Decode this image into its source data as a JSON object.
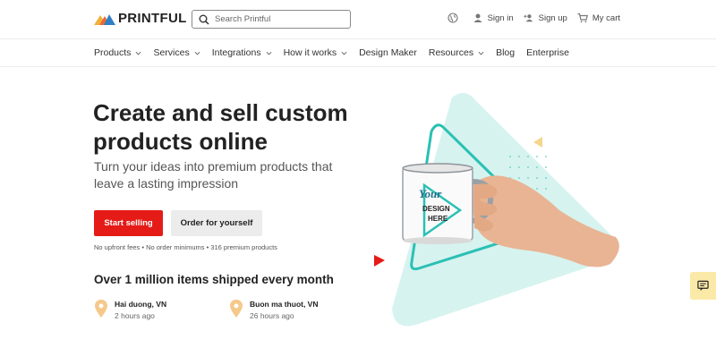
{
  "brand": {
    "name": "PRINTFUL"
  },
  "search": {
    "placeholder": "Search Printful"
  },
  "header_right": {
    "language_icon": "globe-icon",
    "sign_in": "Sign in",
    "sign_up": "Sign up",
    "cart": "My cart"
  },
  "nav": {
    "items": [
      {
        "label": "Products",
        "dropdown": true
      },
      {
        "label": "Services",
        "dropdown": true
      },
      {
        "label": "Integrations",
        "dropdown": true
      },
      {
        "label": "How it works",
        "dropdown": true
      },
      {
        "label": "Design Maker",
        "dropdown": false
      },
      {
        "label": "Resources",
        "dropdown": true
      },
      {
        "label": "Blog",
        "dropdown": false
      },
      {
        "label": "Enterprise",
        "dropdown": false
      }
    ]
  },
  "hero": {
    "title": "Create and sell custom products online",
    "subtitle": "Turn your ideas into premium products that leave a lasting impression",
    "primary_button": "Start selling",
    "secondary_button": "Order for yourself",
    "fineprint": "No upfront fees • No order minimums • 316 premium products"
  },
  "shipped": {
    "heading": "Over 1 million items shipped every month",
    "locations": [
      {
        "place": "Hai duong, VN",
        "time": "2 hours ago"
      },
      {
        "place": "Buon ma thuot, VN",
        "time": "26 hours ago"
      }
    ]
  },
  "mug": {
    "line1": "Your",
    "line2": "DESIGN",
    "line3": "HERE"
  },
  "colors": {
    "accent": "#e41b17",
    "teal": "#2bc0b4",
    "mint": "#d6f3ef",
    "chat_bg": "#fbe9a8"
  }
}
